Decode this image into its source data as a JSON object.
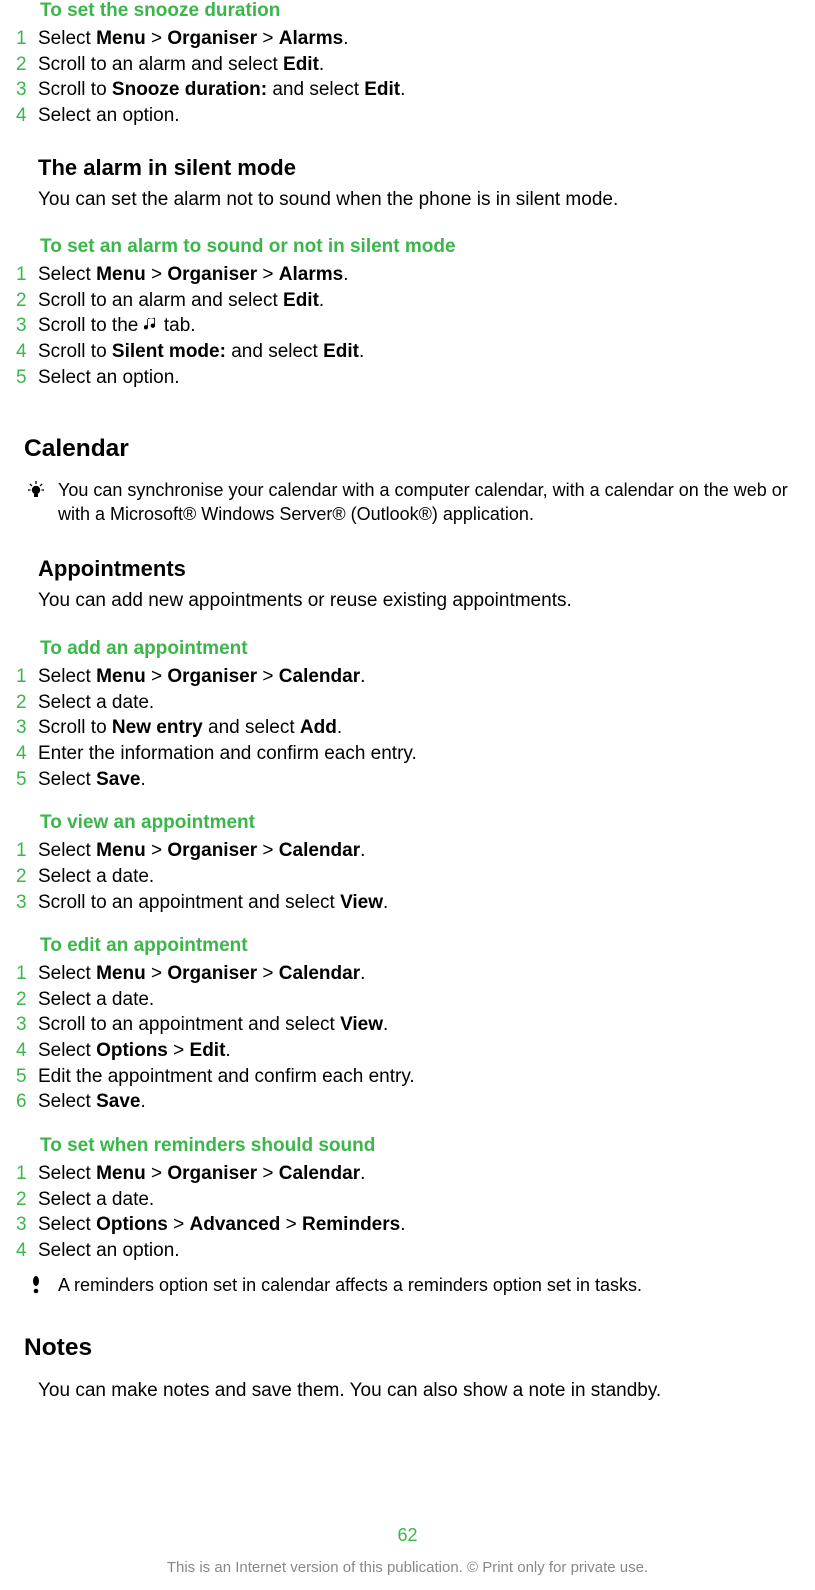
{
  "sec1": {
    "heading": "To set the snooze duration",
    "steps": [
      {
        "num": "1",
        "parts": [
          "Select ",
          "Menu",
          " > ",
          "Organiser",
          " > ",
          "Alarms",
          "."
        ]
      },
      {
        "num": "2",
        "parts": [
          "Scroll to an alarm and select ",
          "Edit",
          "."
        ]
      },
      {
        "num": "3",
        "parts": [
          "Scroll to ",
          "Snooze duration:",
          " and select ",
          "Edit",
          "."
        ]
      },
      {
        "num": "4",
        "parts": [
          "Select an option."
        ]
      }
    ]
  },
  "sec2": {
    "heading": "The alarm in silent mode",
    "body": "You can set the alarm not to sound when the phone is in silent mode."
  },
  "sec3": {
    "heading": "To set an alarm to sound or not in silent mode",
    "steps_a": [
      {
        "num": "1",
        "parts": [
          "Select ",
          "Menu",
          " > ",
          "Organiser",
          " > ",
          "Alarms",
          "."
        ]
      },
      {
        "num": "2",
        "parts": [
          "Scroll to an alarm and select ",
          "Edit",
          "."
        ]
      }
    ],
    "step3_pre": "Scroll to the ",
    "step3_post": " tab.",
    "steps_b": [
      {
        "num": "4",
        "parts": [
          "Scroll to ",
          "Silent mode:",
          " and select ",
          "Edit",
          "."
        ]
      },
      {
        "num": "5",
        "parts": [
          "Select an option."
        ]
      }
    ]
  },
  "calendar": {
    "heading": "Calendar",
    "note": "You can synchronise your calendar with a computer calendar, with a calendar on the web or with a Microsoft® Windows Server® (Outlook®) application."
  },
  "appointments": {
    "heading": "Appointments",
    "body": "You can add new appointments or reuse existing appointments."
  },
  "add_appt": {
    "heading": "To add an appointment",
    "steps": [
      {
        "num": "1",
        "parts": [
          "Select ",
          "Menu",
          " > ",
          "Organiser",
          " > ",
          "Calendar",
          "."
        ]
      },
      {
        "num": "2",
        "parts": [
          "Select a date."
        ]
      },
      {
        "num": "3",
        "parts": [
          "Scroll to ",
          "New entry",
          " and select ",
          "Add",
          "."
        ]
      },
      {
        "num": "4",
        "parts": [
          "Enter the information and confirm each entry."
        ]
      },
      {
        "num": "5",
        "parts": [
          "Select ",
          "Save",
          "."
        ]
      }
    ]
  },
  "view_appt": {
    "heading": "To view an appointment",
    "steps": [
      {
        "num": "1",
        "parts": [
          "Select ",
          "Menu",
          " > ",
          "Organiser",
          " > ",
          "Calendar",
          "."
        ]
      },
      {
        "num": "2",
        "parts": [
          "Select a date."
        ]
      },
      {
        "num": "3",
        "parts": [
          "Scroll to an appointment and select ",
          "View",
          "."
        ]
      }
    ]
  },
  "edit_appt": {
    "heading": "To edit an appointment",
    "steps": [
      {
        "num": "1",
        "parts": [
          "Select ",
          "Menu",
          " > ",
          "Organiser",
          " > ",
          "Calendar",
          "."
        ]
      },
      {
        "num": "2",
        "parts": [
          "Select a date."
        ]
      },
      {
        "num": "3",
        "parts": [
          "Scroll to an appointment and select ",
          "View",
          "."
        ]
      },
      {
        "num": "4",
        "parts": [
          "Select ",
          "Options",
          " > ",
          "Edit",
          "."
        ]
      },
      {
        "num": "5",
        "parts": [
          "Edit the appointment and confirm each entry."
        ]
      },
      {
        "num": "6",
        "parts": [
          "Select ",
          "Save",
          "."
        ]
      }
    ]
  },
  "reminders": {
    "heading": "To set when reminders should sound",
    "steps": [
      {
        "num": "1",
        "parts": [
          "Select ",
          "Menu",
          " > ",
          "Organiser",
          " > ",
          "Calendar",
          "."
        ]
      },
      {
        "num": "2",
        "parts": [
          "Select a date."
        ]
      },
      {
        "num": "3",
        "parts": [
          "Select ",
          "Options",
          " > ",
          "Advanced",
          " > ",
          "Reminders",
          "."
        ]
      },
      {
        "num": "4",
        "parts": [
          "Select an option."
        ]
      }
    ],
    "note": "A reminders option set in calendar affects a reminders option set in tasks."
  },
  "notes": {
    "heading": "Notes",
    "body": "You can make notes and save them. You can also show a note in standby."
  },
  "page_number": "62",
  "footer": "This is an Internet version of this publication. © Print only for private use.",
  "bold_words": [
    "Menu",
    "Organiser",
    "Alarms",
    "Edit",
    "Snooze duration:",
    "Silent mode:",
    "Calendar",
    "New entry",
    "Add",
    "Save",
    "View",
    "Options",
    "Advanced",
    "Reminders"
  ]
}
